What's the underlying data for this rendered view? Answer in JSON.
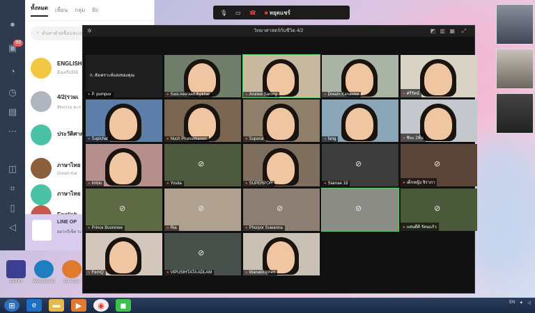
{
  "line": {
    "tabs": [
      "ทั้งหมด",
      "เพื่อน",
      "กลุ่ม",
      "Bc"
    ],
    "search_placeholder": "ค้นหาด้วยชื่อและเบอร์",
    "unread_badge": "99",
    "chats": [
      {
        "name": "ENGLISH",
        "sub": "อีเมลรีบ555",
        "color": "#f2c843"
      },
      {
        "name": "4/2(รวมเ",
        "sub": "สิทธรรม ตะก",
        "color": "#b0b6c0"
      },
      {
        "name": "ประวัติศาส",
        "sub": "",
        "color": "#4bc1a6"
      },
      {
        "name": "ภาษาไทย",
        "sub": "Dream Kar",
        "color": "#8b5e3c"
      },
      {
        "name": "ภาษาไทย",
        "sub": "",
        "color": "#4bc1a6"
      },
      {
        "name": "English",
        "sub": "",
        "color": "#c7574a"
      }
    ],
    "notice_title": "LINE OP",
    "notice_sub": "อยากรีเซ็ต ระบบ ฟังก์ชันฟ..."
  },
  "desktop_icons": [
    {
      "label": "OPPO"
    },
    {
      "label": "Webcamoid"
    },
    {
      "label": "Dlo-Cha"
    }
  ],
  "zoom_bar": {
    "stop_label": "หยุดแชร์"
  },
  "meeting": {
    "title": "วิทยาศาสตร์กับชีวิต 4/2",
    "participants": [
      {
        "name": "P. pumpuv",
        "caption": "ก. สังเคราะห์แสงของคุณ",
        "video": false,
        "bg": "#1f1f1f"
      },
      {
        "name": "Sasi.neeraad.lhpkhai",
        "video": true,
        "bg": "#6f7d6a"
      },
      {
        "name": "Arunee Sarong",
        "video": true,
        "bg": "#c7b8a0",
        "active": true
      },
      {
        "name": "Dream Kanawee",
        "video": true,
        "bg": "#a9b4a6"
      },
      {
        "name": "ศรีรัตน์",
        "video": true,
        "bg": "#d8d3c4"
      },
      {
        "name": "Supichat",
        "video": true,
        "bg": "#5c7ea8"
      },
      {
        "name": "Nuch Phasukkanon",
        "video": true,
        "bg": "#7a6650"
      },
      {
        "name": "Suparat",
        "video": true,
        "bg": "#8e7f6a"
      },
      {
        "name": "fang",
        "video": true,
        "bg": "#8aa5b8"
      },
      {
        "name": "ชิบะ 2ชั้น",
        "video": true,
        "bg": "#c4c8cc"
      },
      {
        "name": "Imbio",
        "video": true,
        "bg": "#b58f8c"
      },
      {
        "name": "Yosita",
        "video": false,
        "bg": "#4e5a3e"
      },
      {
        "name": "SUPERPOR",
        "video": true,
        "bg": "#7d6e5e"
      },
      {
        "name": "Siamae 18",
        "video": false,
        "bg": "#3c3c3c"
      },
      {
        "name": "เด็กหญิง จิราภา",
        "video": false,
        "bg": "#5b4438"
      },
      {
        "name": "Prince Boonmee",
        "video": false,
        "bg": "#5d6a44"
      },
      {
        "name": "Ria",
        "video": false,
        "bg": "#b0a090"
      },
      {
        "name": "Phorpor Suwanna",
        "video": false,
        "bg": "#8c7e72"
      },
      {
        "name": "",
        "video": false,
        "bg": "#8c8c86",
        "active": true
      },
      {
        "name": "แสนดีดี รัตนแก้ว",
        "video": false,
        "bg": "#4a5a3a"
      },
      {
        "name": "FernQ",
        "video": true,
        "bg": "#d3c6bc"
      },
      {
        "name": "VIPUSIHTATA ADLAM",
        "video": false,
        "bg": "#47504a"
      },
      {
        "name": "Wanalshiphen",
        "video": true,
        "bg": "#c9c0b6"
      }
    ]
  },
  "taskbar": {
    "apps": [
      "ie-icon",
      "folder-icon",
      "media-icon",
      "chrome-icon",
      "line-icon"
    ],
    "tray_text": "EN"
  }
}
